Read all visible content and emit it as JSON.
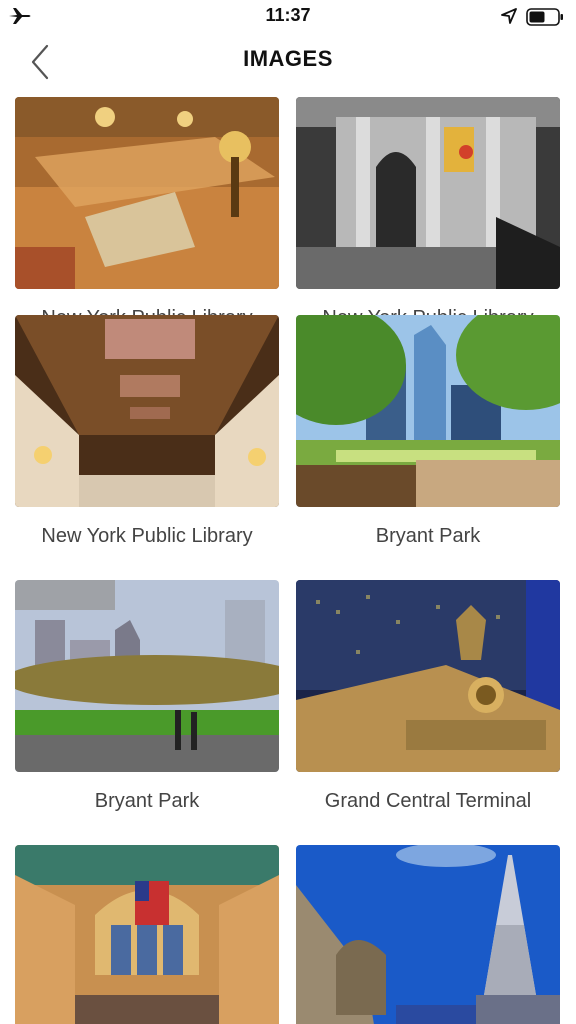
{
  "status": {
    "time": "11:37"
  },
  "nav": {
    "title": "IMAGES"
  },
  "images": [
    {
      "caption": "New York Public Library",
      "icon": "library-reading-room-photo"
    },
    {
      "caption": "New York Public Library",
      "icon": "library-facade-photo"
    },
    {
      "caption": "New York Public Library",
      "icon": "library-ceiling-photo"
    },
    {
      "caption": "Bryant Park",
      "icon": "bryant-park-skyline-photo"
    },
    {
      "caption": "Bryant Park",
      "icon": "bryant-park-lawn-photo"
    },
    {
      "caption": "Grand Central Terminal",
      "icon": "grand-central-facade-photo"
    },
    {
      "caption": "",
      "icon": "grand-central-concourse-photo"
    },
    {
      "caption": "",
      "icon": "chrysler-building-photo"
    }
  ]
}
